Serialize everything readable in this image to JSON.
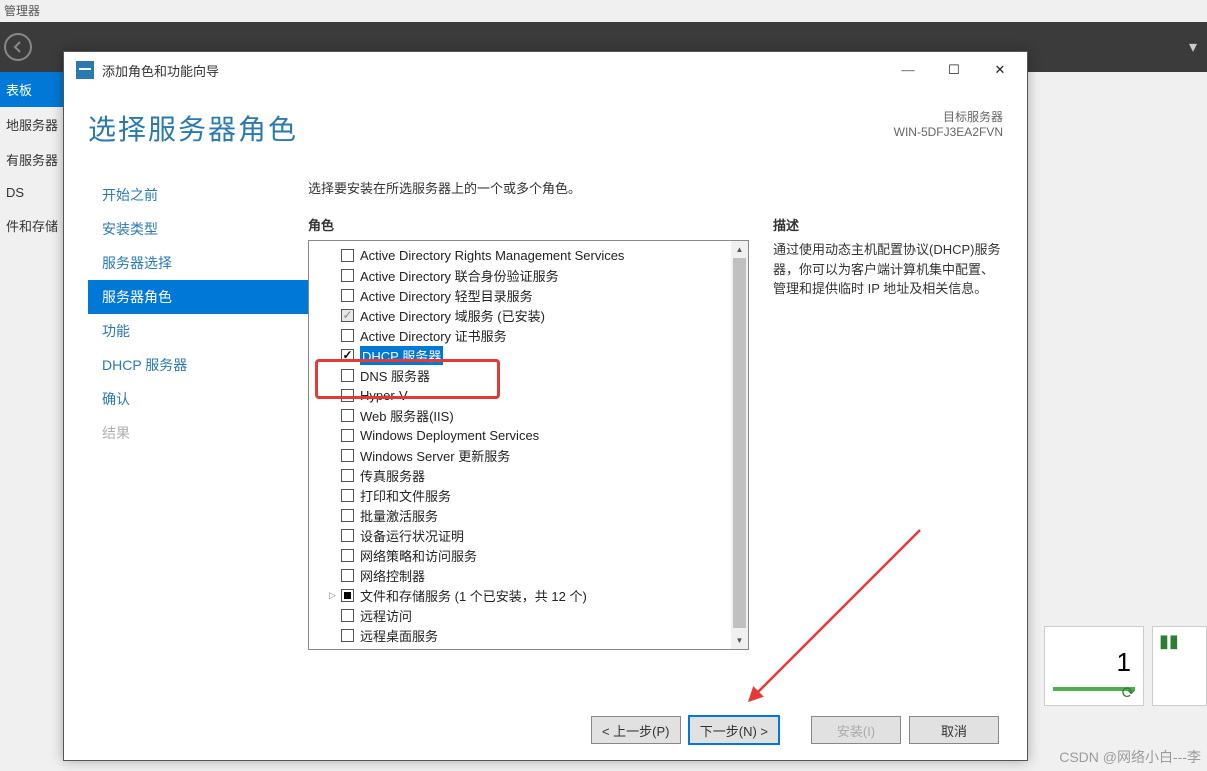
{
  "bg": {
    "title_fragment": "管理器",
    "nav": [
      {
        "label": "表板",
        "active": true
      },
      {
        "label": "地服务器"
      },
      {
        "label": "有服务器"
      },
      {
        "label": "DS"
      },
      {
        "label": "件和存储"
      }
    ],
    "tile_number": "1"
  },
  "dialog": {
    "window_title": "添加角色和功能向导",
    "heading": "选择服务器角色",
    "target_label": "目标服务器",
    "target_server": "WIN-5DFJ3EA2FVN",
    "instruction": "选择要安装在所选服务器上的一个或多个角色。",
    "roles_label": "角色",
    "desc_label": "描述",
    "description": "通过使用动态主机配置协议(DHCP)服务器，你可以为客户端计算机集中配置、管理和提供临时 IP 地址及相关信息。",
    "steps": [
      {
        "label": "开始之前",
        "state": "normal"
      },
      {
        "label": "安装类型",
        "state": "normal"
      },
      {
        "label": "服务器选择",
        "state": "normal"
      },
      {
        "label": "服务器角色",
        "state": "active"
      },
      {
        "label": "功能",
        "state": "normal"
      },
      {
        "label": "DHCP 服务器",
        "state": "normal"
      },
      {
        "label": "确认",
        "state": "normal"
      },
      {
        "label": "结果",
        "state": "disabled"
      }
    ],
    "roles": [
      {
        "label": "Active Directory Rights Management Services",
        "checked": false
      },
      {
        "label": "Active Directory 联合身份验证服务",
        "checked": false
      },
      {
        "label": "Active Directory 轻型目录服务",
        "checked": false
      },
      {
        "label": "Active Directory 域服务 (已安装)",
        "checked": true,
        "installed": true
      },
      {
        "label": "Active Directory 证书服务",
        "checked": false
      },
      {
        "label": "DHCP 服务器",
        "checked": true,
        "selected": true
      },
      {
        "label": "DNS 服务器",
        "checked": false
      },
      {
        "label": "Hyper-V",
        "checked": false
      },
      {
        "label": "Web 服务器(IIS)",
        "checked": false
      },
      {
        "label": "Windows Deployment Services",
        "checked": false
      },
      {
        "label": "Windows Server 更新服务",
        "checked": false
      },
      {
        "label": "传真服务器",
        "checked": false
      },
      {
        "label": "打印和文件服务",
        "checked": false
      },
      {
        "label": "批量激活服务",
        "checked": false
      },
      {
        "label": "设备运行状况证明",
        "checked": false
      },
      {
        "label": "网络策略和访问服务",
        "checked": false
      },
      {
        "label": "网络控制器",
        "checked": false
      },
      {
        "label": "文件和存储服务 (1 个已安装，共 12 个)",
        "checked": false,
        "partial": true,
        "expandable": true
      },
      {
        "label": "远程访问",
        "checked": false
      },
      {
        "label": "远程桌面服务",
        "checked": false
      }
    ],
    "buttons": {
      "prev": "< 上一步(P)",
      "next": "下一步(N) >",
      "install": "安装(I)",
      "cancel": "取消"
    }
  },
  "watermark": "CSDN @网络小白---李"
}
